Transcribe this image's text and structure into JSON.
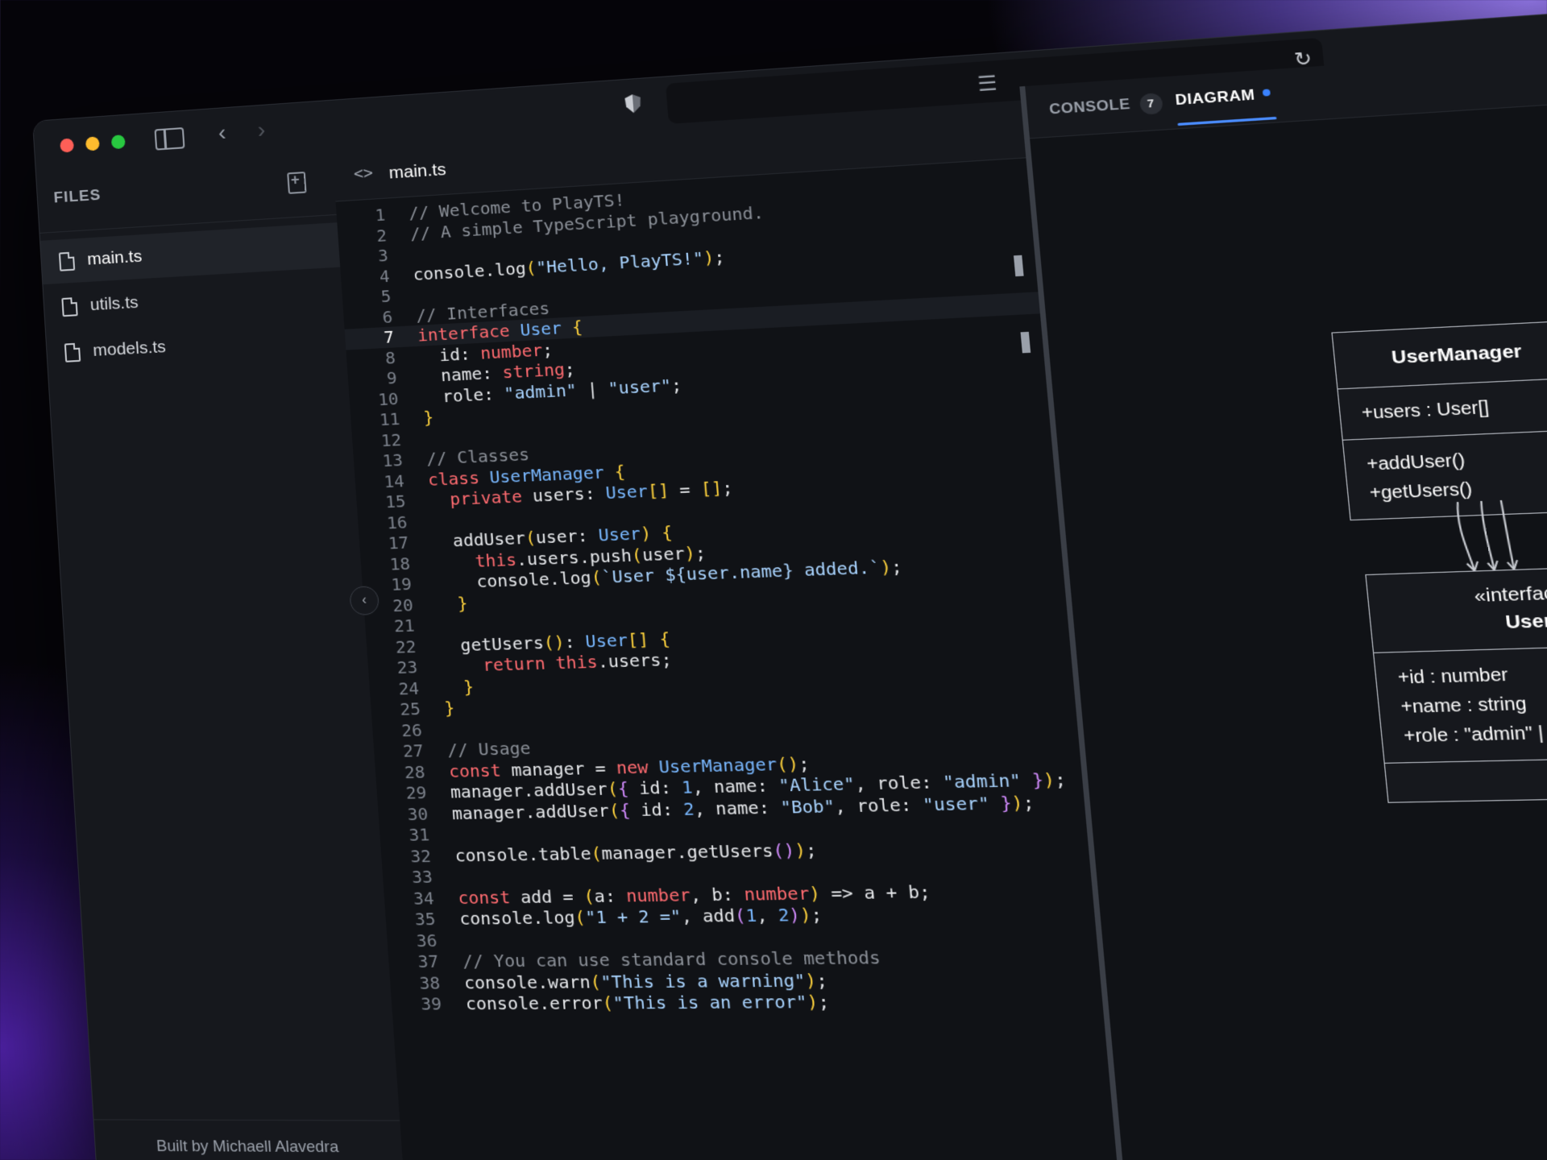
{
  "titlebar": {
    "url": "",
    "reload_icon": "reload-icon",
    "shield_icon": "shield-icon"
  },
  "sidebar": {
    "title": "FILES",
    "files": [
      {
        "name": "main.ts",
        "active": true
      },
      {
        "name": "utils.ts",
        "active": false
      },
      {
        "name": "models.ts",
        "active": false
      }
    ],
    "footer": "Built by Michaell Alavedra"
  },
  "editor": {
    "tab_icon": "<>",
    "tab_name": "main.ts",
    "current_line": 7,
    "lines": [
      "// Welcome to PlayTS!",
      "// A simple TypeScript playground.",
      "",
      "console.log(\"Hello, PlayTS!\");",
      "",
      "// Interfaces",
      "interface User {",
      "  id: number;",
      "  name: string;",
      "  role: \"admin\" | \"user\";",
      "}",
      "",
      "// Classes",
      "class UserManager {",
      "  private users: User[] = [];",
      "",
      "  addUser(user: User) {",
      "    this.users.push(user);",
      "    console.log(`User ${user.name} added.`);",
      "  }",
      "",
      "  getUsers(): User[] {",
      "    return this.users;",
      "  }",
      "}",
      "",
      "// Usage",
      "const manager = new UserManager();",
      "manager.addUser({ id: 1, name: \"Alice\", role: \"admin\" });",
      "manager.addUser({ id: 2, name: \"Bob\", role: \"user\" });",
      "",
      "console.table(manager.getUsers());",
      "",
      "const add = (a: number, b: number) => a + b;",
      "console.log(\"1 + 2 =\", add(1, 2));",
      "",
      "// You can use standard console methods",
      "console.warn(\"This is a warning\");",
      "console.error(\"This is an error\");"
    ]
  },
  "panel": {
    "tabs": [
      {
        "label": "CONSOLE",
        "badge": "7"
      },
      {
        "label": "DIAGRAM"
      }
    ],
    "diagram": {
      "usermanager": {
        "name": "UserManager",
        "attributes": [
          "+users : User[]"
        ],
        "methods": [
          "+addUser()",
          "+getUsers()"
        ]
      },
      "user": {
        "stereotype": "«interface»",
        "name": "User",
        "attributes": [
          "+id : number",
          "+name : string",
          "+role : \"admin\" | \"user\""
        ]
      }
    }
  },
  "colors": {
    "keyword": "#ff6b70",
    "type": "#79b8ff",
    "string": "#a9d4ff",
    "comment": "#8b9098",
    "accent": "#3a82ff"
  }
}
